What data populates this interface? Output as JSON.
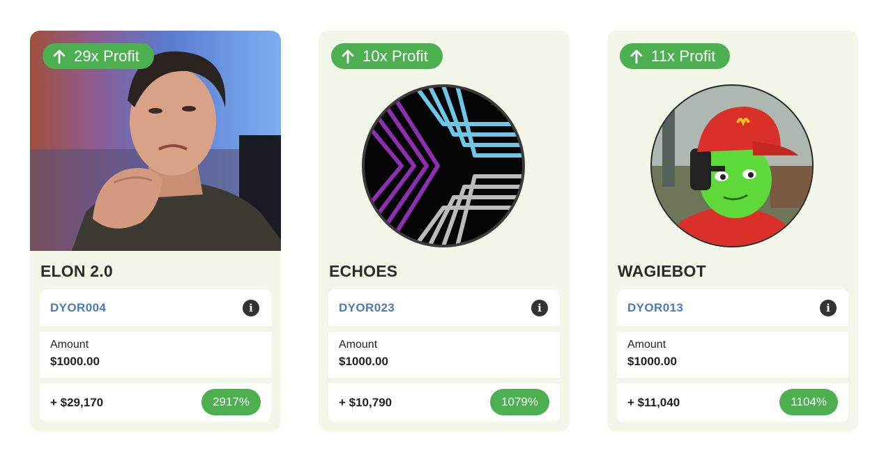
{
  "cards": [
    {
      "badge": "29x Profit",
      "name": "ELON 2.0",
      "code": "DYOR004",
      "amount_label": "Amount",
      "amount": "$1000.00",
      "gain": "+ $29,170",
      "percent": "2917%",
      "image": "elon-photo"
    },
    {
      "badge": "10x Profit",
      "name": "ECHOES",
      "code": "DYOR023",
      "amount_label": "Amount",
      "amount": "$1000.00",
      "gain": "+ $10,790",
      "percent": "1079%",
      "image": "echoes-logo"
    },
    {
      "badge": "11x Profit",
      "name": "WAGIEBOT",
      "code": "DYOR013",
      "amount_label": "Amount",
      "amount": "$1000.00",
      "gain": "+ $11,040",
      "percent": "1104%",
      "image": "wagiebot-avatar"
    }
  ],
  "colors": {
    "card_bg": "#f3f7e9",
    "accent_green": "#4caf50",
    "code_blue": "#4a7bbf",
    "text_dark": "#222222"
  },
  "icons": {
    "badge": "arrow-up-icon",
    "info": "info-icon"
  }
}
